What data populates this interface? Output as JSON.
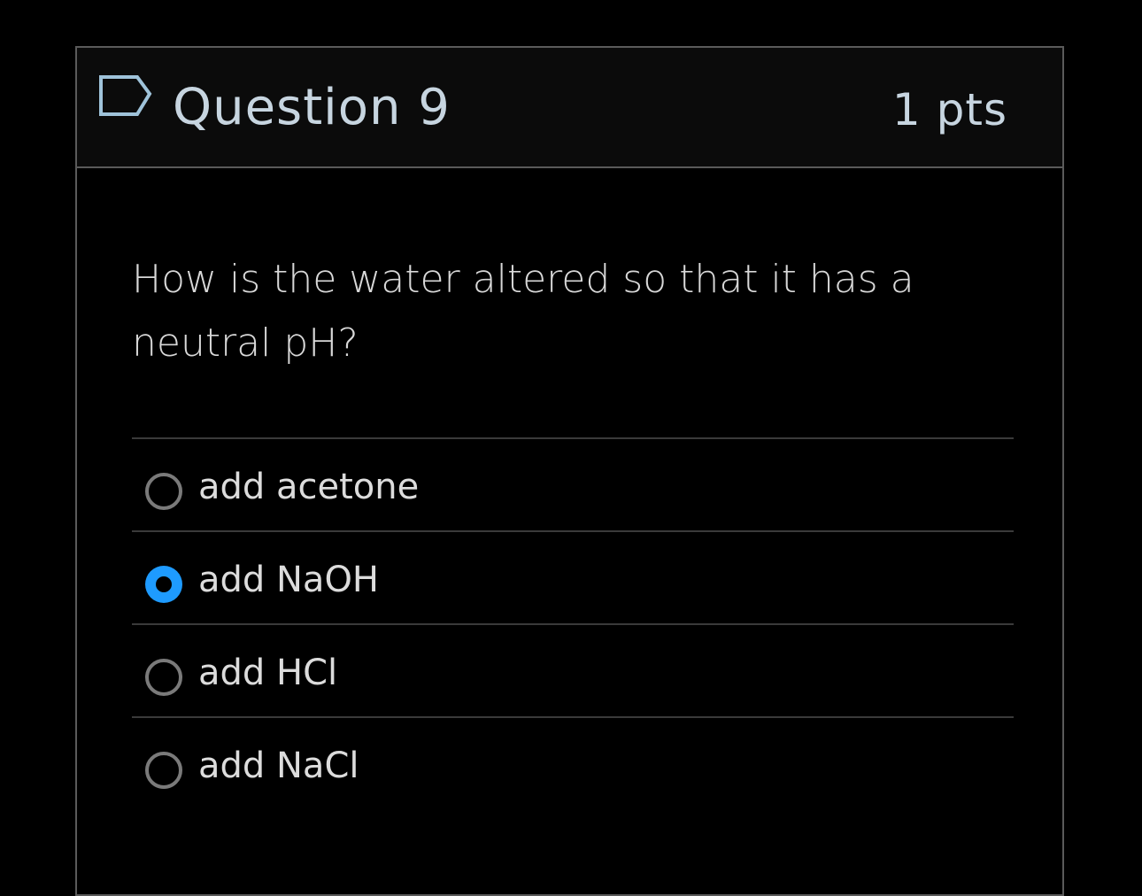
{
  "question": {
    "title": "Question 9",
    "points": "1 pts",
    "flag_icon": "flag-icon",
    "text": "How is the water altered so that it has a neutral pH?"
  },
  "answers": [
    {
      "label": "add acetone",
      "selected": false
    },
    {
      "label": "add NaOH",
      "selected": true
    },
    {
      "label": "add HCl",
      "selected": false
    },
    {
      "label": "add NaCl",
      "selected": false
    }
  ],
  "colors": {
    "accent": "#1e9bff",
    "header_text": "#c7d5e0",
    "border": "#5a5a5a"
  }
}
